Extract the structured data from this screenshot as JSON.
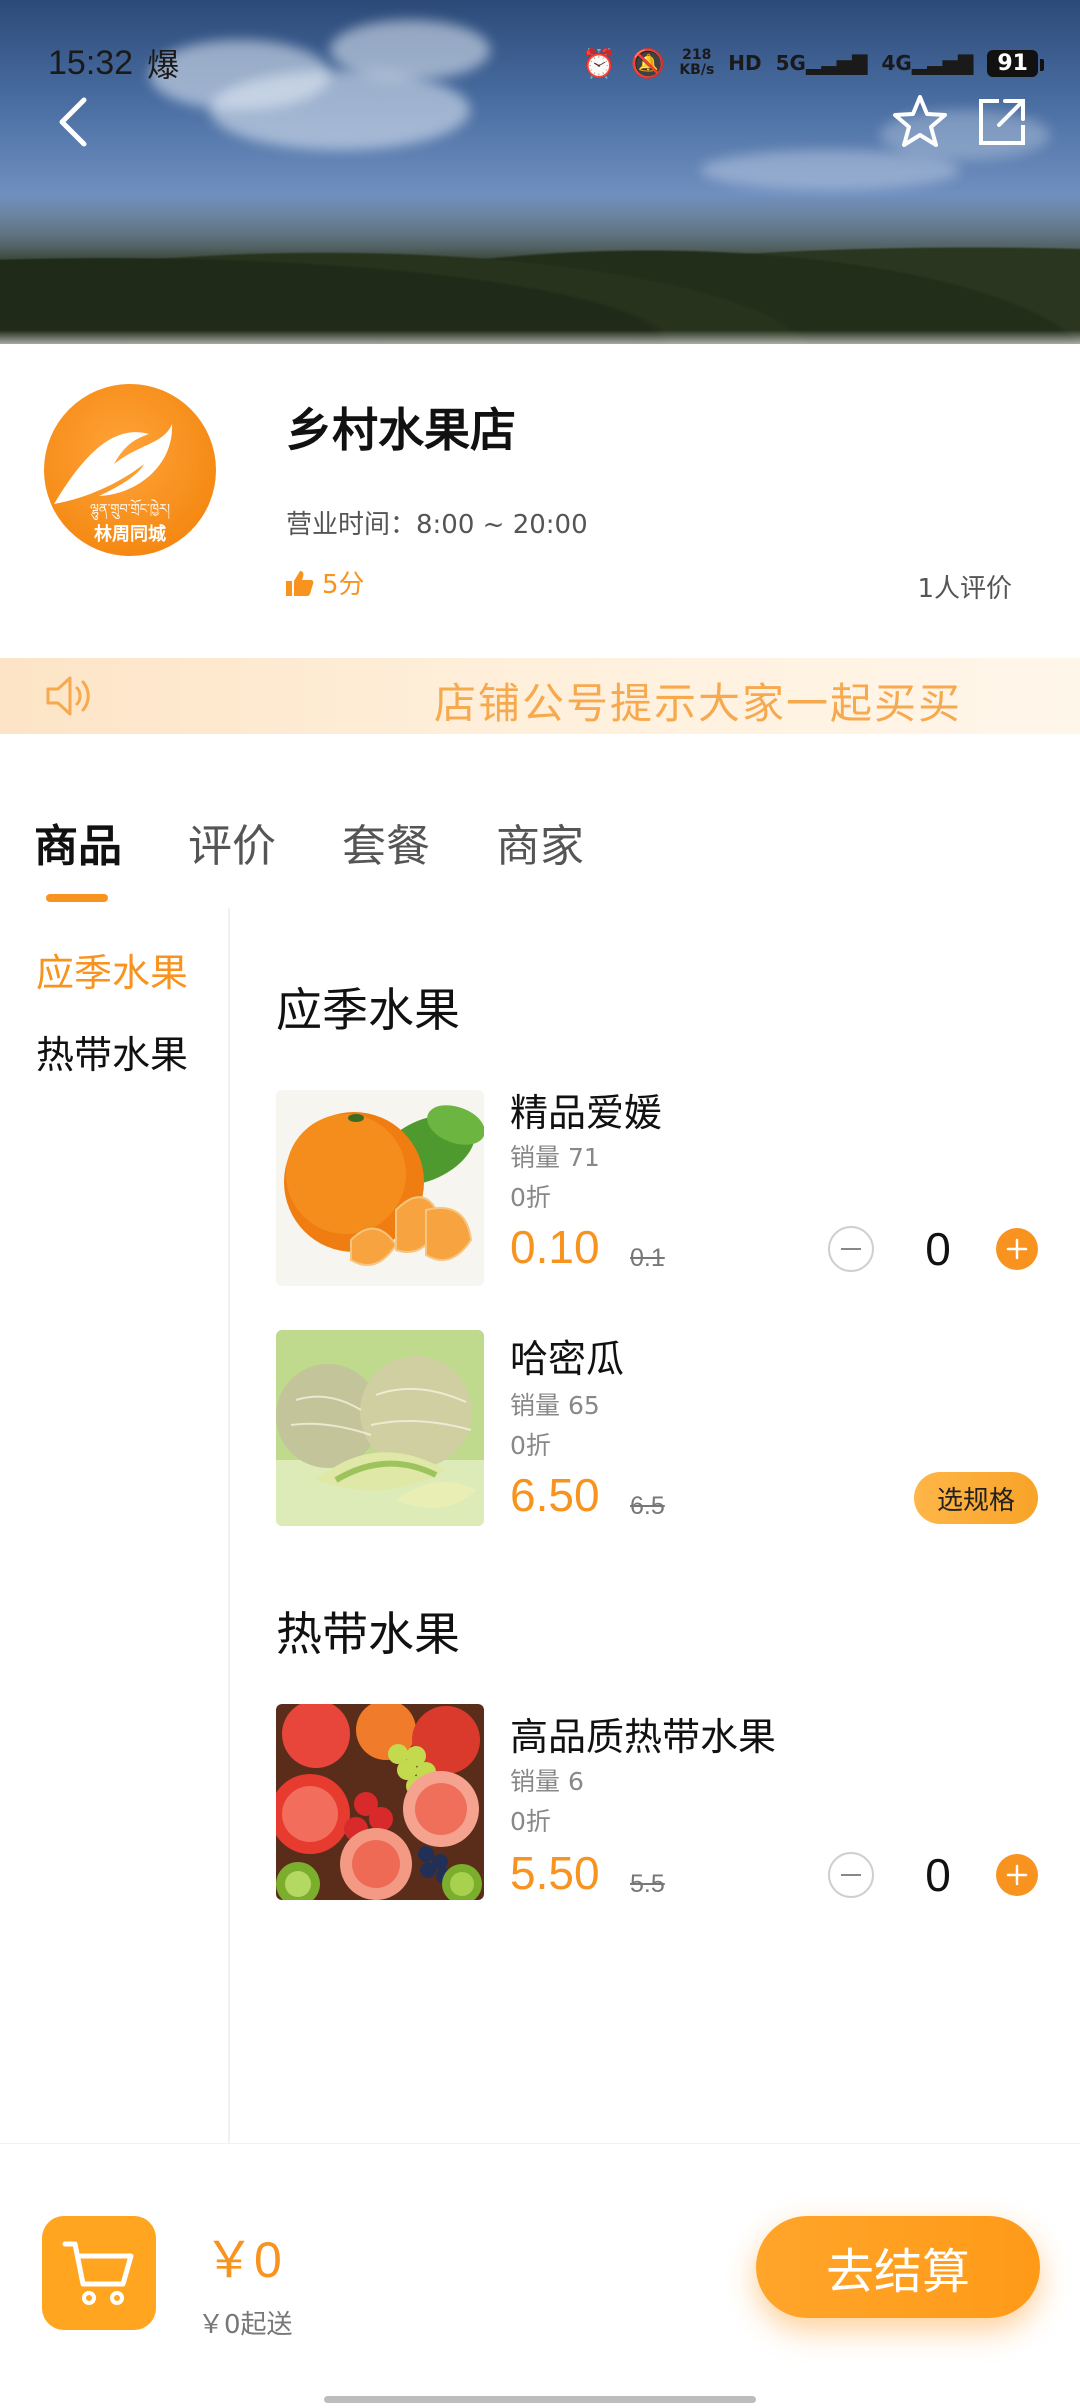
{
  "status_bar": {
    "time": "15:32",
    "extra": "爆",
    "net_speed_top": "218",
    "net_speed_bottom": "KB/s",
    "hd": "HD",
    "sig1": "5G",
    "sig2": "4G",
    "battery": "91"
  },
  "header": {
    "back_icon": "chevron-left-icon",
    "favorite_icon": "star-icon",
    "share_icon": "share-icon"
  },
  "shop": {
    "name": "乡村水果店",
    "hours": "营业时间：8:00 ~ 20:00",
    "rating": "5分",
    "reviews": "1人评价",
    "logo_text": "林周同城",
    "logo_script": "ལྷུན་གྲུབ་གྲོང་ཁྱེར།"
  },
  "notice": {
    "text": "店铺公号提示大家一起买买"
  },
  "tabs": [
    {
      "label": "商品",
      "active": true
    },
    {
      "label": "评价",
      "active": false
    },
    {
      "label": "套餐",
      "active": false
    },
    {
      "label": "商家",
      "active": false
    }
  ],
  "sidebar": {
    "items": [
      {
        "label": "应季水果",
        "active": true
      },
      {
        "label": "热带水果",
        "active": false
      }
    ]
  },
  "categories": [
    {
      "title": "应季水果",
      "products": [
        {
          "name": "精品爱媛",
          "sales": "销量 71",
          "discount": "0折",
          "price": "0.10",
          "original": "0.1",
          "quantity": "0",
          "action": "stepper"
        },
        {
          "name": "哈密瓜",
          "sales": "销量 65",
          "discount": "0折",
          "price": "6.50",
          "original": "6.5",
          "action": "spec",
          "spec_label": "选规格"
        }
      ]
    },
    {
      "title": "热带水果",
      "products": [
        {
          "name": "高品质热带水果",
          "sales": "销量 6",
          "discount": "0折",
          "price": "5.50",
          "original": "5.5",
          "quantity": "0",
          "action": "stepper"
        }
      ]
    }
  ],
  "cart": {
    "total": "￥0",
    "minimum": "￥0起送",
    "checkout_label": "去结算"
  },
  "colors": {
    "accent": "#f7931e",
    "notice_text": "#f7a94e",
    "notice_bg": "#fde4c6"
  }
}
